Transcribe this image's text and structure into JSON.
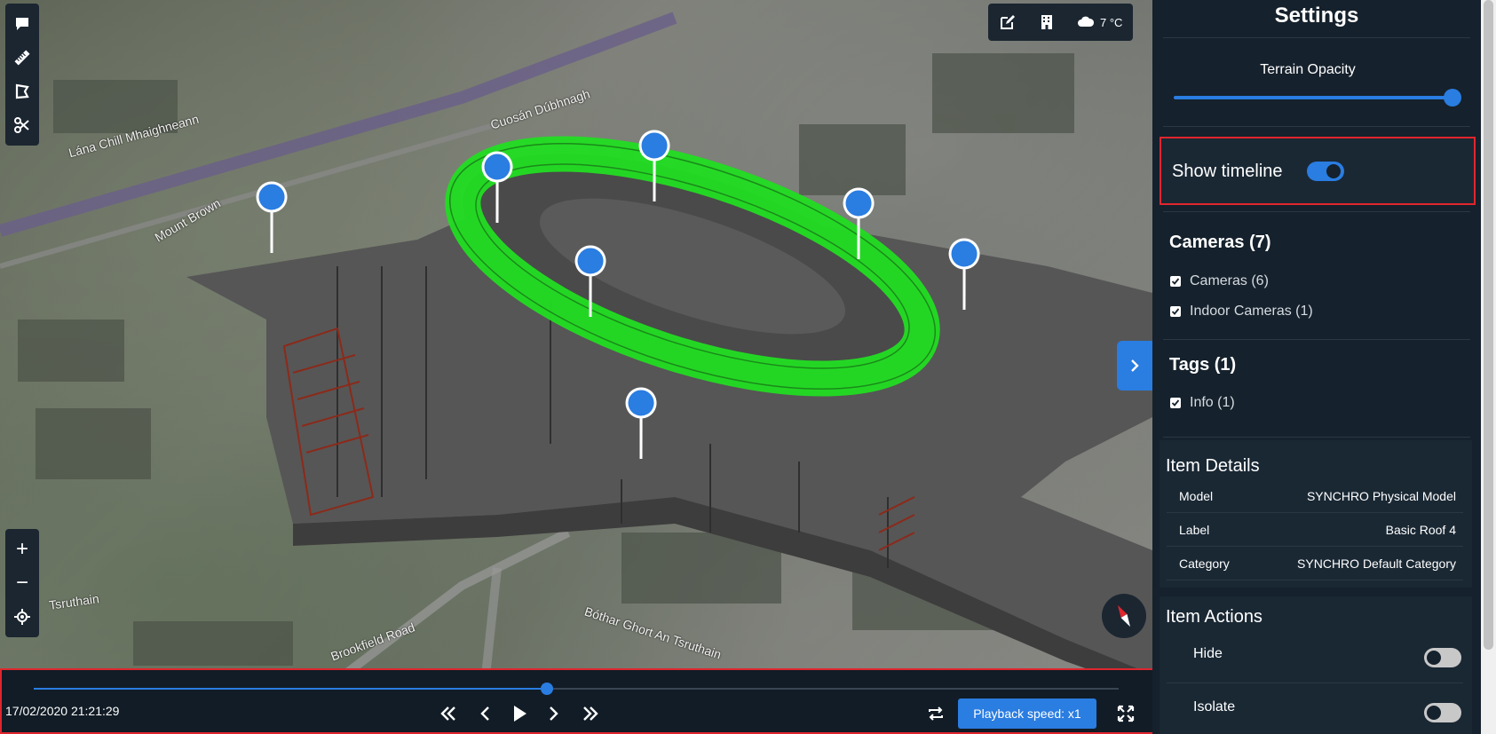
{
  "map": {
    "labels": [
      "Brookfield Road",
      "Bóthar Ghort An Tsruthain",
      "Tsruthain",
      "Mount Brown",
      "Lána Chill Mhaighneann",
      "Cuosán Dúbhnagh"
    ]
  },
  "left_toolbar": {
    "icons": [
      "comment-icon",
      "ruler-icon",
      "area-icon",
      "scissors-icon"
    ]
  },
  "zoom_toolbar": {
    "zoom_in": "+",
    "zoom_out": "−"
  },
  "top_bar": {
    "weather": "7 °C"
  },
  "timeline": {
    "date": "17/02/2020 21:21:29",
    "progress": 0.473,
    "playback_speed": "Playback speed: x1"
  },
  "settings": {
    "title": "Settings",
    "terrain_opacity_label": "Terrain Opacity",
    "terrain_opacity": 1.0,
    "show_timeline_label": "Show timeline",
    "show_timeline": true,
    "cameras": {
      "heading": "Cameras (7)",
      "items": [
        "Cameras (6)",
        "Indoor Cameras (1)"
      ]
    },
    "tags": {
      "heading": "Tags (1)",
      "items": [
        "Info (1)"
      ]
    },
    "item_details": {
      "heading": "Item Details",
      "rows": [
        {
          "key": "Model",
          "value": "SYNCHRO Physical Model"
        },
        {
          "key": "Label",
          "value": "Basic Roof 4"
        },
        {
          "key": "Category",
          "value": "SYNCHRO Default Category"
        }
      ]
    },
    "item_actions": {
      "heading": "Item Actions",
      "rows": [
        {
          "label": "Hide",
          "on": false
        },
        {
          "label": "Isolate",
          "on": false
        }
      ]
    }
  },
  "colors": {
    "accent": "#2a7de1",
    "highlight": "#e0262e",
    "selection": "#22dd22",
    "panel": "#15212c"
  }
}
